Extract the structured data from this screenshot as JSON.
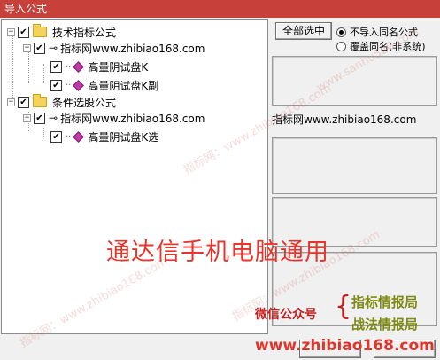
{
  "window": {
    "title": "导入公式"
  },
  "tree": {
    "groups": [
      {
        "label": "技术指标公式",
        "checked": "true",
        "source": "指标网www.zhibiao168.com",
        "items": [
          "高量阴试盘K",
          "高量阴试盘K副"
        ]
      },
      {
        "label": "条件选股公式",
        "checked": "true",
        "source": "指标网www.zhibiao168.com",
        "items": [
          "高量阴试盘K选"
        ]
      }
    ]
  },
  "panel": {
    "select_all_label": "全部选中",
    "radio_options": [
      "不导入同名公式",
      "覆盖同名(非系统)"
    ],
    "selected_radio": 0,
    "source_text": "指标网www.zhibiao168.com"
  },
  "watermarks": {
    "site": "指标网：www.zhibiao168.com",
    "site2": "www.sanhu520.com"
  },
  "overlay": {
    "banner": "通达信手机电脑通用",
    "wechat_label": "微信公众号",
    "promo_line1": "指标情报局",
    "promo_line2": "战法情报局",
    "domain": "www.zhibiao168.com"
  },
  "colors": {
    "titlebar": "#c8403a",
    "banner": "#e8342a"
  }
}
